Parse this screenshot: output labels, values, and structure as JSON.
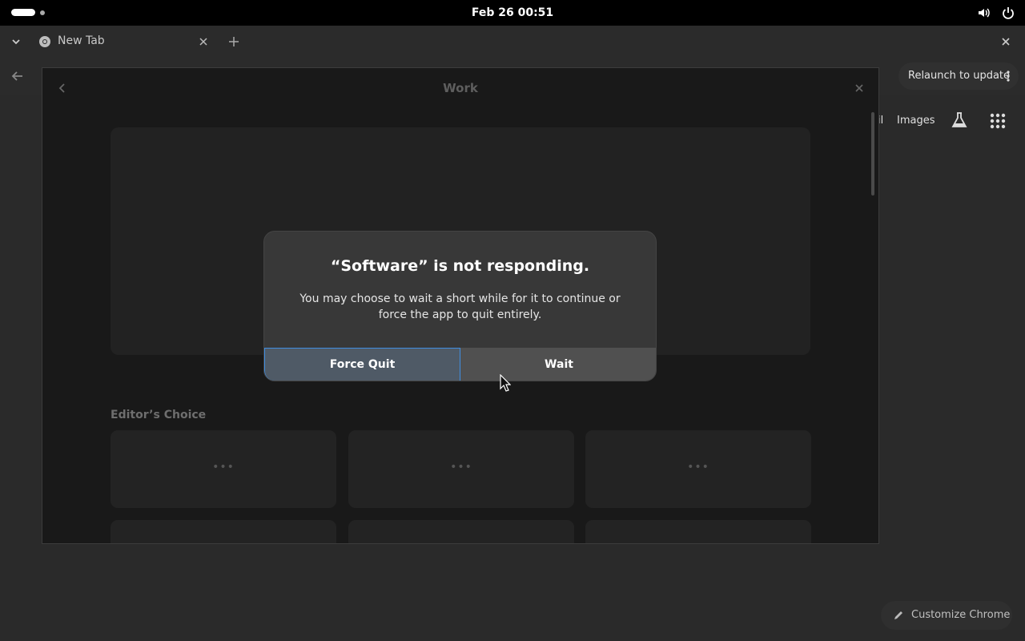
{
  "topbar": {
    "clock": "Feb 26  00:51"
  },
  "browser": {
    "tab_title": "New Tab",
    "relaunch_label": "Relaunch to update",
    "gmail_fragment": "il",
    "images_label": "Images",
    "customize_label": "Customize Chrome"
  },
  "software_window": {
    "title": "Work",
    "section_title": "Editor’s Choice",
    "card_placeholder": "•••"
  },
  "dialog": {
    "title": "“Software” is not responding.",
    "body": "You may choose to wait a short while for it to continue or force the app to quit entirely.",
    "force_quit_label": "Force Quit",
    "wait_label": "Wait"
  },
  "icons": {
    "tab_dropdown": "chevron-down-icon",
    "favicon": "chrome-icon",
    "back": "arrow-left-icon",
    "labs": "flask-icon",
    "apps": "grid-icon",
    "pencil": "pencil-icon",
    "volume": "volume-icon",
    "power": "power-icon"
  },
  "colors": {
    "accent": "#3f8de0",
    "dialog_bg": "#383838",
    "window_bg": "#191919"
  }
}
